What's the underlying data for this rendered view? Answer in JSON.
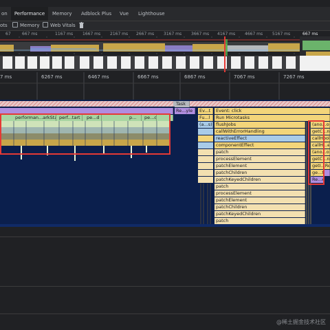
{
  "tabs": [
    {
      "label": "on",
      "active": false
    },
    {
      "label": "Performance",
      "active": true
    },
    {
      "label": "Memory",
      "active": false
    },
    {
      "label": "Adblock Plus",
      "active": false
    },
    {
      "label": "Vue",
      "active": false
    },
    {
      "label": "Lighthouse",
      "active": false
    }
  ],
  "options": {
    "screenshots": "ots",
    "memory": "Memory",
    "web_vitals": "Web Vitals"
  },
  "overview_ticks": [
    "67",
    "667 ms",
    "1167 ms",
    "1667 ms",
    "2167 ms",
    "2667 ms",
    "3167 ms",
    "3667 ms",
    "4167 ms",
    "4667 ms",
    "5167 ms",
    "667 ms"
  ],
  "main_ticks": [
    "7 ms",
    "6267 ms",
    "6467 ms",
    "6667 ms",
    "6867 ms",
    "7067 ms",
    "7267 ms"
  ],
  "flame": {
    "task": "Task",
    "recalc": "Re...yle",
    "ev": "Ev...t",
    "fu": "Fu...l",
    "a_s": "(a...s)",
    "event_click": "Event: click",
    "run_microtasks": "Run Microtasks",
    "left_labels": [
      "performan...arkStart",
      "perf...tart",
      "pe...d",
      "p...",
      "pe...d"
    ],
    "stack": [
      "flushJobs",
      "callWithErrorHandling",
      "reactiveEffect",
      "componentEffect",
      "patch",
      "processElement",
      "patchElement",
      "patchChildren",
      "patchKeyedChildren",
      "patch",
      "processElement",
      "patchElement",
      "patchChildren",
      "patchKeyedChildren",
      "patch"
    ],
    "right_stack": [
      "(ano...ous)",
      "getC...nd",
      "callHook",
      "callH...er",
      "(ano...ous)",
      "getC...nd",
      "getI...Rec",
      "ge...t",
      "Re...e"
    ]
  },
  "watermark": "@稀土掘金技术社区",
  "colors": {
    "yellow": "#f3d57a",
    "purple": "#b08ee0",
    "blue": "#a9cbe8",
    "green": "#a8d5a2",
    "red_outline": "#e53935",
    "flame_bg": "#0b1f4d"
  }
}
